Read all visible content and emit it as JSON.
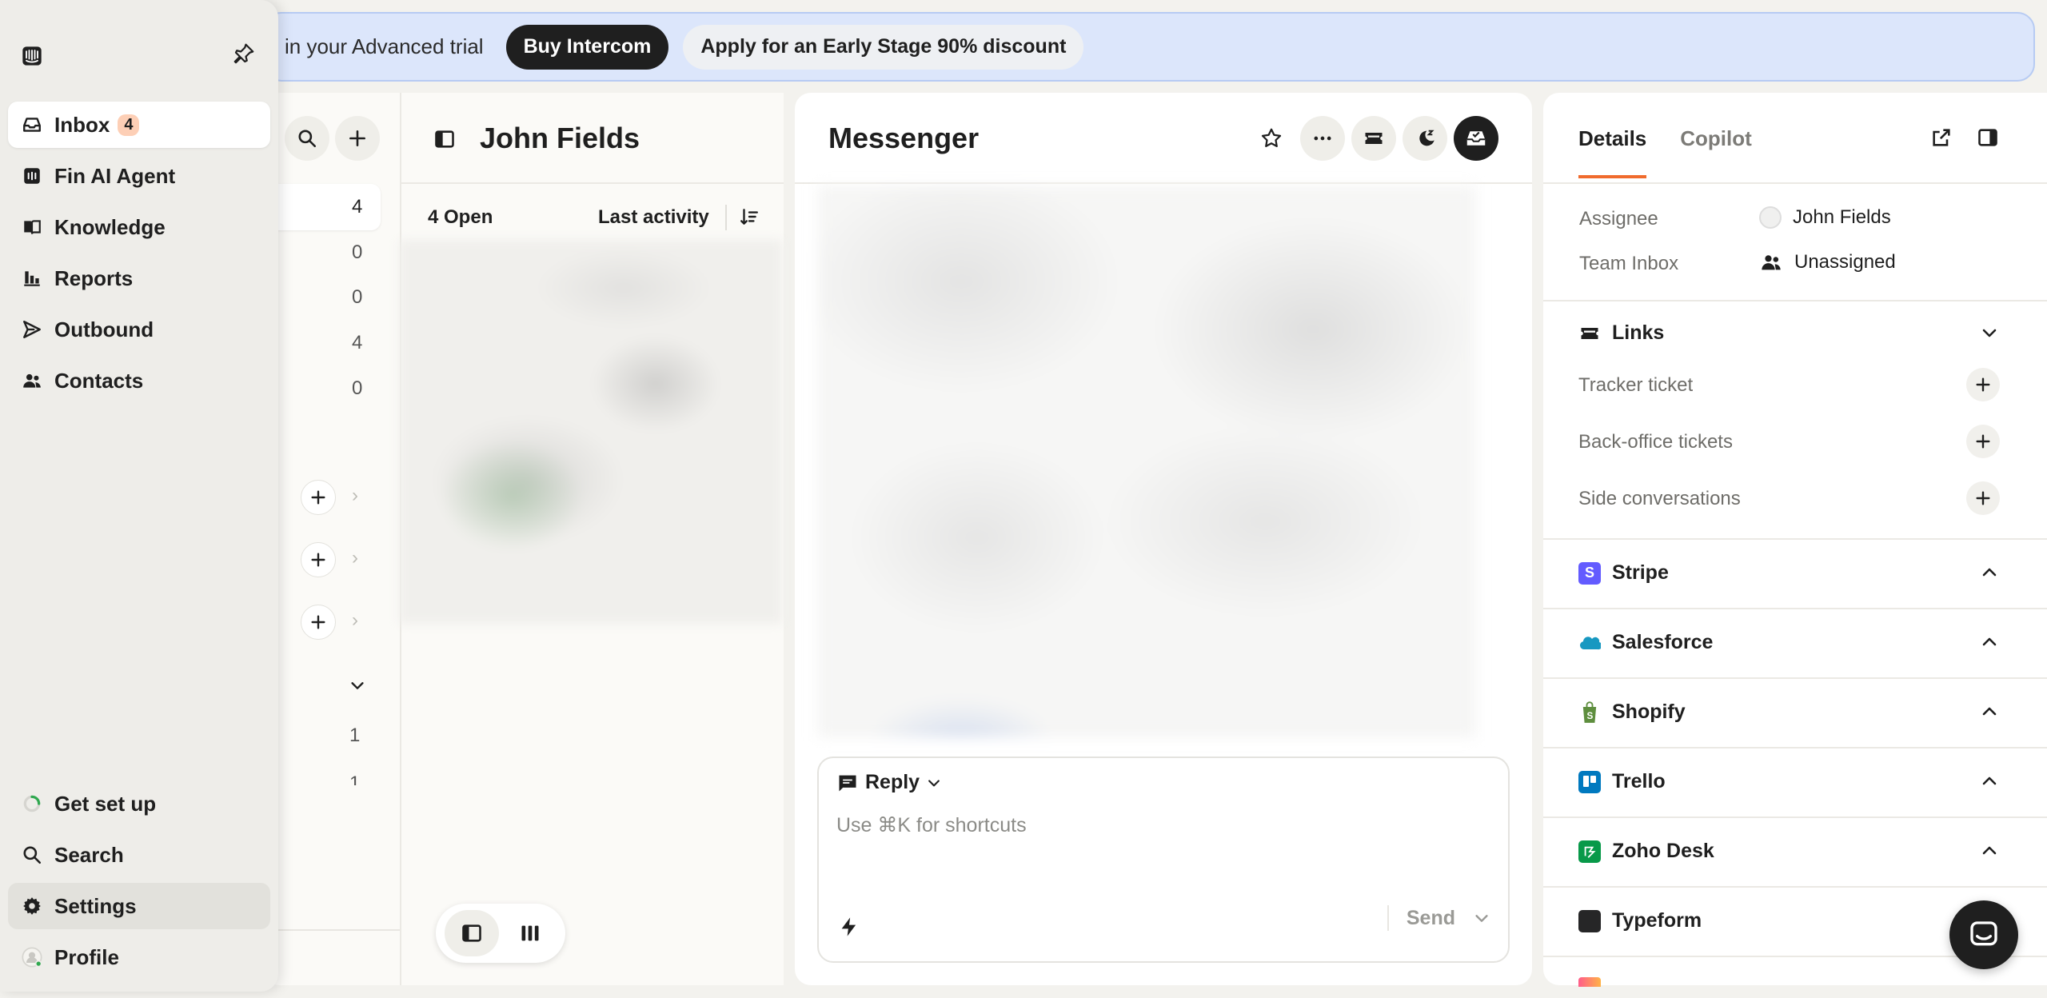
{
  "banner": {
    "text": "in your Advanced trial",
    "buy_label": "Buy Intercom",
    "discount_label": "Apply for an Early Stage 90% discount"
  },
  "nav": {
    "items": [
      {
        "label": "Inbox",
        "badge": "4",
        "icon": "inbox-icon"
      },
      {
        "label": "Fin AI Agent",
        "icon": "fin-icon"
      },
      {
        "label": "Knowledge",
        "icon": "book-icon"
      },
      {
        "label": "Reports",
        "icon": "bar-chart-icon"
      },
      {
        "label": "Outbound",
        "icon": "send-icon"
      },
      {
        "label": "Contacts",
        "icon": "people-icon"
      }
    ],
    "bottom": [
      {
        "label": "Get set up",
        "icon": "progress-ring-icon"
      },
      {
        "label": "Search",
        "icon": "search-icon"
      },
      {
        "label": "Settings",
        "icon": "gear-icon"
      },
      {
        "label": "Profile",
        "icon": "avatar-icon"
      }
    ]
  },
  "inbox_counts": [
    "4",
    "0",
    "0",
    "4",
    "0",
    "1",
    "1"
  ],
  "list": {
    "title": "John Fields",
    "open_count": "4 Open",
    "sort_label": "Last activity"
  },
  "conversation": {
    "title": "Messenger",
    "reply_label": "Reply",
    "composer_placeholder": "Use ⌘K for shortcuts",
    "send_label": "Send"
  },
  "details": {
    "tabs": [
      "Details",
      "Copilot"
    ],
    "assignee_label": "Assignee",
    "assignee_value": "John Fields",
    "team_label": "Team Inbox",
    "team_value": "Unassigned",
    "links_title": "Links",
    "links": [
      "Tracker ticket",
      "Back-office tickets",
      "Side conversations"
    ],
    "apps": [
      {
        "name": "Stripe",
        "color": "#635bff"
      },
      {
        "name": "Salesforce",
        "color": "#1798c1"
      },
      {
        "name": "Shopify",
        "color": "#5e8e3e"
      },
      {
        "name": "Trello",
        "color": "#0079bf"
      },
      {
        "name": "Zoho Desk",
        "color": "#089949"
      },
      {
        "name": "Typeform",
        "color": "#262627"
      }
    ]
  },
  "colors": {
    "accent": "#f06b2d",
    "banner_bg": "#dce6fb",
    "dark": "#1f1f1f"
  }
}
